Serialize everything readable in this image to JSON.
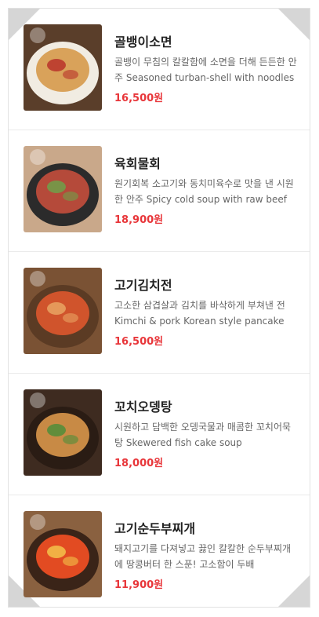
{
  "menu": {
    "items": [
      {
        "name": "골뱅이소면",
        "description": "골뱅이 무침의 칼칼함에 소면을 더해 든든한 안주 Seasoned turban-shell with noodles",
        "price": "16,500원",
        "image": "golbaengi-somyeon-photo",
        "colors": {
          "bg": "#5a3e2a",
          "plate": "#f1ece2",
          "food": "#d9a25a",
          "accent": "#b8322a"
        }
      },
      {
        "name": "육회물회",
        "description": "원기회복 소고기와 동치미육수로 맛을 낸 시원한 안주 Spicy cold soup with raw beef",
        "price": "18,900원",
        "image": "yukhoe-mulhoe-photo",
        "colors": {
          "bg": "#c9a88a",
          "plate": "#2b2b2b",
          "food": "#b54a3a",
          "accent": "#6fa04a"
        }
      },
      {
        "name": "고기김치전",
        "description": "고소한 삼겹살과 김치를 바삭하게 부쳐낸 전 Kimchi & pork Korean style pancake",
        "price": "16,500원",
        "image": "kimchi-jeon-photo",
        "colors": {
          "bg": "#7a5234",
          "plate": "#5b3b24",
          "food": "#d0542c",
          "accent": "#e9a463"
        }
      },
      {
        "name": "꼬치오뎅탕",
        "description": "시원하고 담백한 오뎅국물과 매콤한 꼬치어묵탕 Skewered fish cake soup",
        "price": "18,000원",
        "image": "odeng-tang-photo",
        "colors": {
          "bg": "#3e2b20",
          "plate": "#2a1c14",
          "food": "#c88a45",
          "accent": "#4f8d3a"
        }
      },
      {
        "name": "고기순두부찌개",
        "description": "돼지고기를 다져넣고 끓인 칼칼한 순두부찌개에 땅콩버터 한 스푼! 고소함이 두배",
        "price": "11,900원",
        "image": "sundubu-jjigae-photo",
        "colors": {
          "bg": "#8a6140",
          "plate": "#3a2418",
          "food": "#e24b22",
          "accent": "#f3c24a"
        }
      }
    ]
  }
}
